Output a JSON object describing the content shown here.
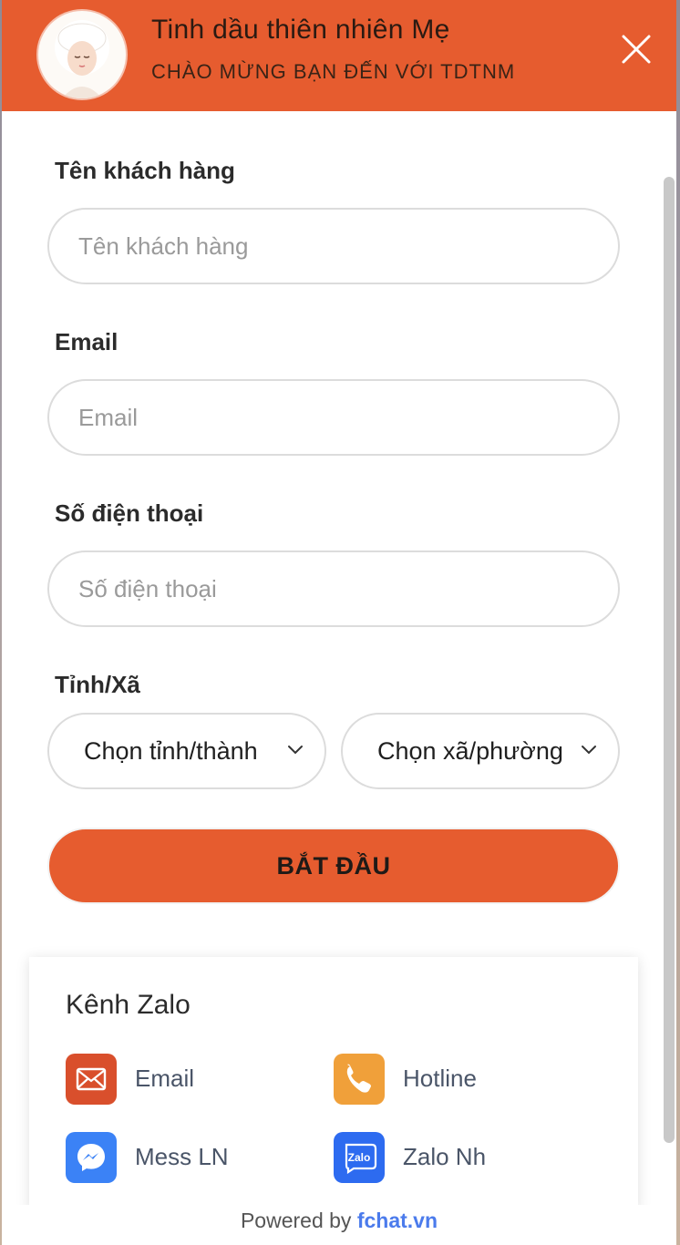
{
  "header": {
    "title": "Tinh dầu thiên nhiên Mẹ",
    "subtitle": "CHÀO MỪNG BẠN ĐẾN VỚI TDTNM"
  },
  "form": {
    "name": {
      "label": "Tên khách hàng",
      "placeholder": "Tên khách hàng"
    },
    "email": {
      "label": "Email",
      "placeholder": "Email"
    },
    "phone": {
      "label": "Số điện thoại",
      "placeholder": "Số điện thoại"
    },
    "location": {
      "label": "Tỉnh/Xã",
      "province_value": "Chọn tỉnh/thành",
      "ward_value": "Chọn xã/phường"
    },
    "start_label": "BẮT ĐẦU"
  },
  "channels": {
    "title": "Kênh Zalo",
    "items": [
      {
        "label": "Email",
        "icon": "email-icon",
        "color": "#d94f2c"
      },
      {
        "label": "Hotline",
        "icon": "phone-icon",
        "color": "#f0a03a"
      },
      {
        "label": "Mess LN",
        "icon": "messenger-icon",
        "color": "#3b82f6"
      },
      {
        "label": "Zalo Nh",
        "icon": "zalo-icon",
        "color": "#2d6bf0"
      }
    ]
  },
  "footer": {
    "prefix": "Powered by",
    "brand": "fchat.vn"
  },
  "colors": {
    "accent": "#e65c2f",
    "link": "#4b7bec"
  }
}
